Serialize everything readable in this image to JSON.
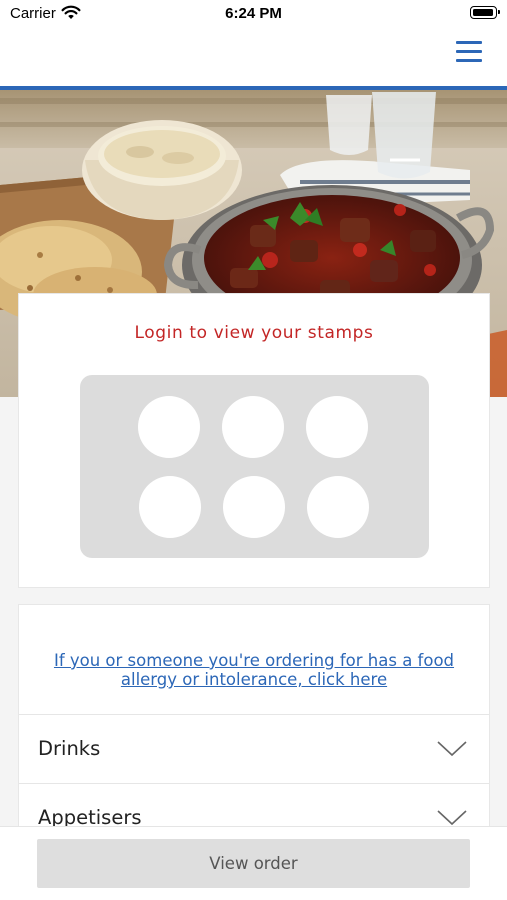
{
  "status_bar": {
    "carrier": "Carrier",
    "time": "6:24 PM"
  },
  "nav": {
    "menu_icon": "hamburger-menu-icon",
    "accent": "#2c67b7"
  },
  "hero": {
    "image": "curry-pan-rice-naan-photo"
  },
  "stamps": {
    "title": "Login to view your stamps",
    "slot_count": 6,
    "title_color": "#c32626"
  },
  "allergy": {
    "link_text": "If you or someone you're ordering for has a food allergy or intolerance, click here"
  },
  "menu": {
    "categories": [
      {
        "label": "Drinks",
        "icon": "chevron-down-icon"
      },
      {
        "label": "Appetisers",
        "icon": "chevron-down-icon"
      }
    ]
  },
  "order": {
    "button_label": "View order"
  }
}
